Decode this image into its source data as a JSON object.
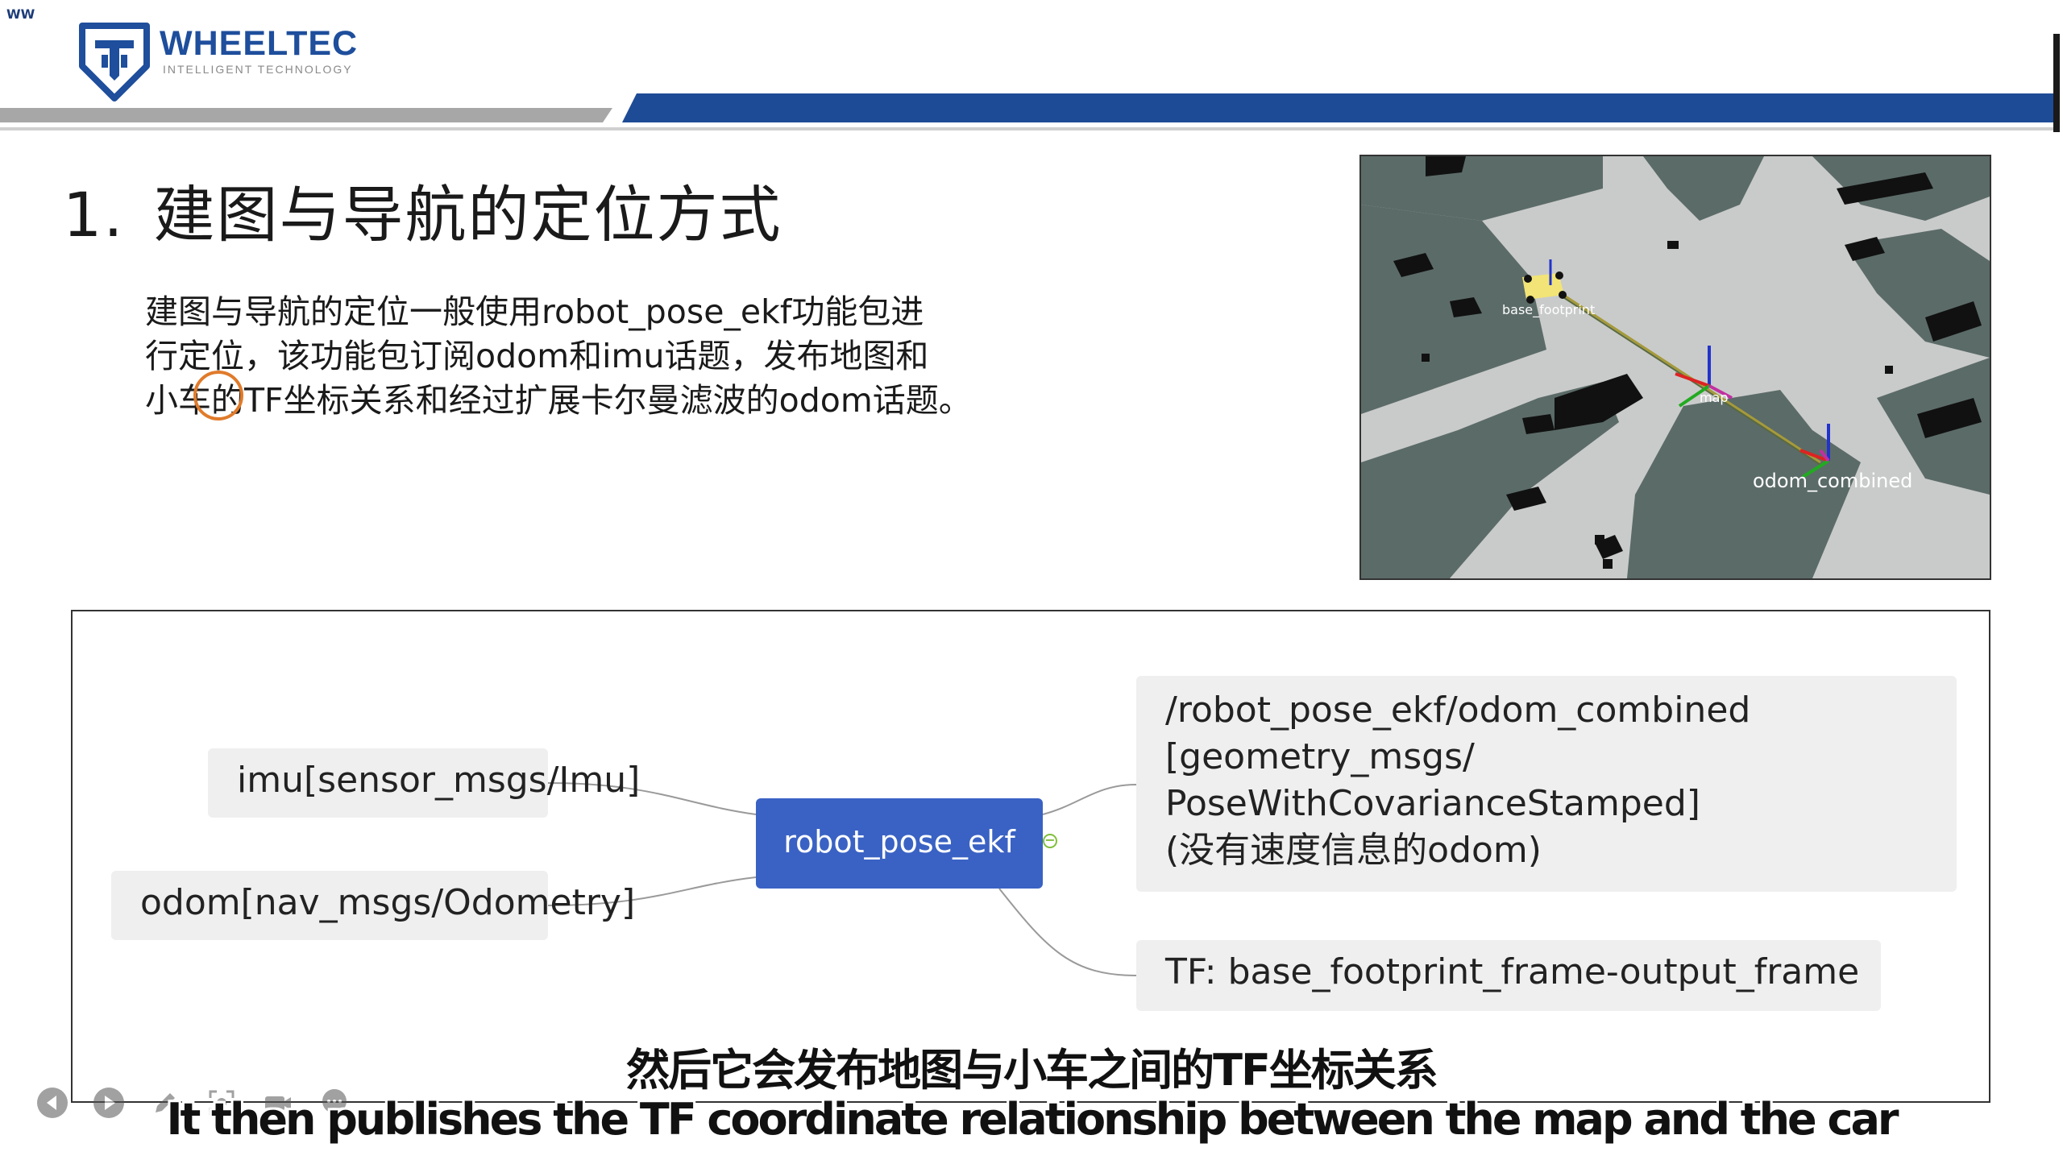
{
  "header": {
    "corner_label": "WW",
    "brand": "WHEELTEC",
    "tagline": "INTELLIGENT TECHNOLOGY",
    "colors": {
      "brand_blue": "#1e4e9c",
      "band_blue": "#1e4b95",
      "band_gray": "#a7a7a7"
    }
  },
  "slide": {
    "title_number": "1.",
    "title_text": "建图与导航的定位方式",
    "description_lines": [
      "建图与导航的定位一般使用robot_pose_ekf功能包进",
      "行定位，该功能包订阅odom和imu话题，发布地图和",
      "小车的TF坐标关系和经过扩展卡尔曼滤波的odom话题。"
    ]
  },
  "map_view": {
    "label_base": "base_footprint",
    "label_map": "map",
    "label_odom": "odom_combined"
  },
  "mindmap": {
    "center": "robot_pose_ekf",
    "inputs": [
      "imu[sensor_msgs/Imu]",
      "odom[nav_msgs/Odometry]"
    ],
    "output_combined_lines": [
      "/robot_pose_ekf/odom_combined",
      "[geometry_msgs/",
      "PoseWithCovarianceStamped]",
      "(没有速度信息的odom)"
    ],
    "output_tf": "TF: base_footprint_frame-output_frame",
    "colors": {
      "center_bg": "#3a62c4",
      "node_bg": "#efefef",
      "line": "#9a9a9a"
    }
  },
  "player": {
    "controls": [
      "previous-icon",
      "play-icon",
      "pen-icon",
      "screenshot-icon",
      "camera-icon",
      "chat-icon"
    ]
  },
  "subtitles": {
    "zh": "然后它会发布地图与小车之间的TF坐标关系",
    "en": "It then publishes the TF coordinate relationship between the map and the car"
  }
}
